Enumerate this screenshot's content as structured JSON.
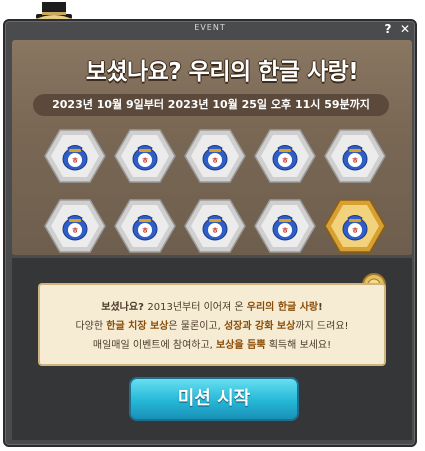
{
  "window": {
    "title": "EVENT",
    "help_label": "?",
    "close_label": "✕"
  },
  "heading": "보셨나요? 우리의 한글 사랑!",
  "date_range": "2023년 10월 9일부터 2023년 10월 25일 오후 11시 59분까지",
  "rewards": {
    "row1": [
      "locked",
      "locked",
      "locked",
      "locked",
      "locked"
    ],
    "row2": [
      "locked",
      "locked",
      "locked",
      "locked",
      "current"
    ],
    "icon": "hangul-gift-pouch-icon"
  },
  "notice": {
    "line1": [
      "보셨나요? ",
      "2013년부터 이어져 온 ",
      "우리의 한글 사랑",
      "!"
    ],
    "line2": [
      "다양한 ",
      "한글 치장 보상",
      "은 물론이고, ",
      "성장과 강화 보상",
      "까지 드려요!"
    ],
    "line3": [
      "매일매일 이벤트에 참여하고, ",
      "보상을 듬뿍",
      " 획득해 보세요!"
    ]
  },
  "start_button": "미션 시작",
  "colors": {
    "accent": "#25b7d7",
    "gold": "#d7a032",
    "panel": "#7a6855"
  }
}
